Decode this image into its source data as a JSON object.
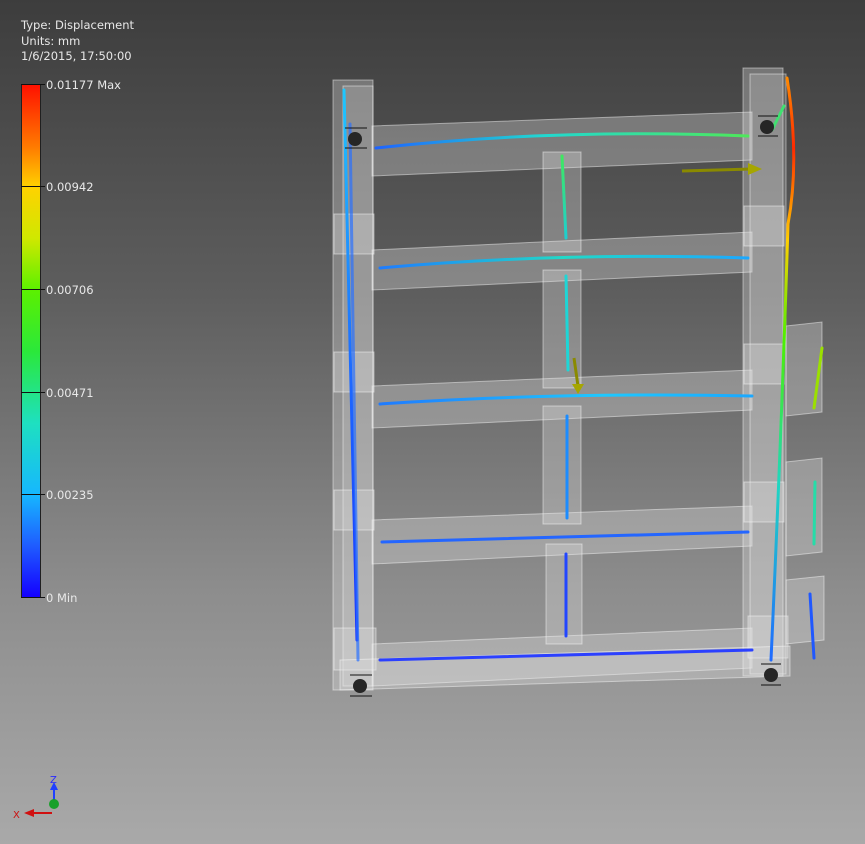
{
  "result_info": {
    "type": "Type: Displacement",
    "units": "Units: mm",
    "timestamp": "1/6/2015, 17:50:00"
  },
  "legend": {
    "ticks": [
      {
        "label": "0.01177 Max",
        "fraction": 1.0
      },
      {
        "label": "0.00942",
        "fraction": 0.8
      },
      {
        "label": "0.00706",
        "fraction": 0.6
      },
      {
        "label": "0.00471",
        "fraction": 0.4
      },
      {
        "label": "0.00235",
        "fraction": 0.2
      },
      {
        "label": "0 Min",
        "fraction": 0.0
      }
    ]
  },
  "triad": {
    "z_label": "Z",
    "x_label": "X"
  },
  "colors": {
    "max": "#ff1100",
    "min": "#1400ff",
    "background_top": "#3d3d3d",
    "background_bottom": "#a9a9a9"
  }
}
